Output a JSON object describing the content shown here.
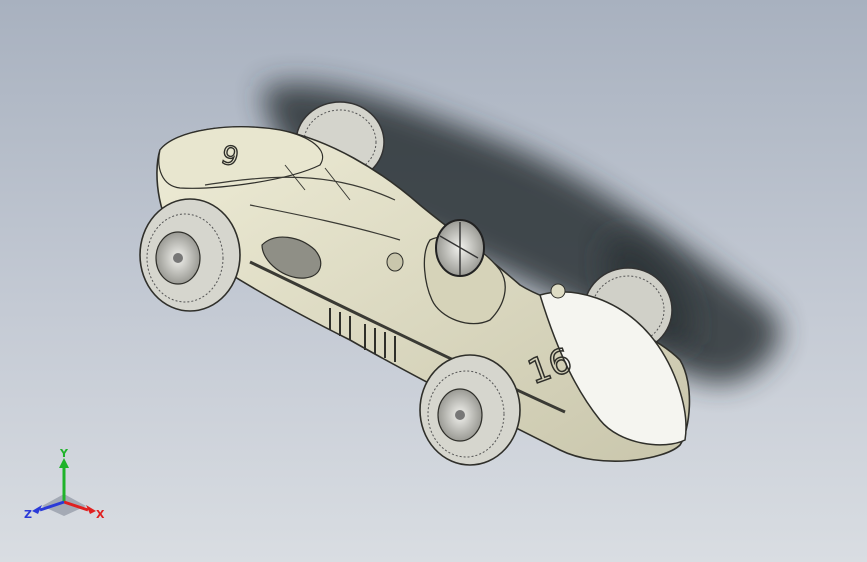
{
  "viewport": {
    "background_top": "#a8b1bf",
    "background_bottom": "#d9dde2"
  },
  "model": {
    "body_color": "#e4e2c9",
    "shadow_color": "#2c3036",
    "tyre_color": "#cfcfc8",
    "nose_number": "6",
    "side_number": "16"
  },
  "triad": {
    "x_label": "X",
    "y_label": "Y",
    "z_label": "Z",
    "x_color": "#e02020",
    "y_color": "#1fb32a",
    "z_color": "#2a3ad8"
  }
}
